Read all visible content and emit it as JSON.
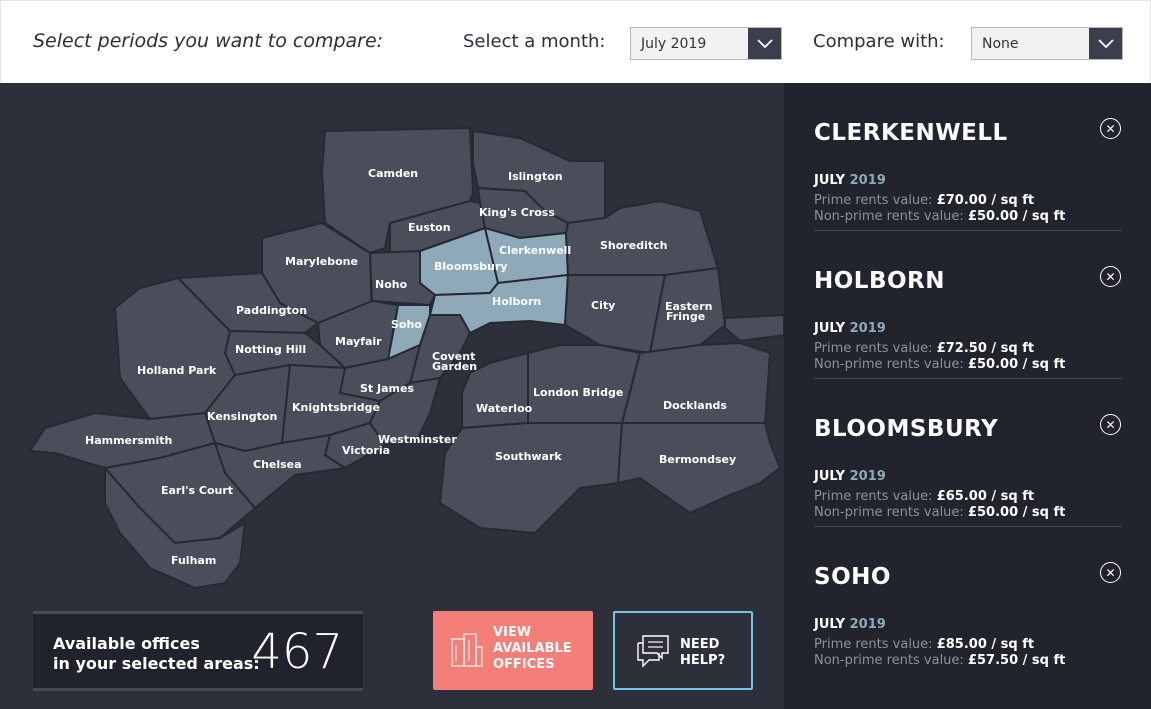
{
  "topbar": {
    "prompt": "Select periods you want to compare:",
    "month_label": "Select a month:",
    "month_value": "July 2019",
    "compare_label": "Compare with:",
    "compare_value": "None"
  },
  "colors": {
    "map_background": "#2d303a",
    "region": "#4a4e5b",
    "region_selected": "#8ea9b8",
    "side_panel": "#21242c",
    "view_button": "#f47f78",
    "help_border": "#6ec6e6"
  },
  "map": {
    "regions": [
      {
        "id": "camden",
        "label": "Camden",
        "selected": false
      },
      {
        "id": "islington",
        "label": "Islington",
        "selected": false
      },
      {
        "id": "kings-cross",
        "label": "King's Cross",
        "selected": false
      },
      {
        "id": "euston",
        "label": "Euston",
        "selected": false
      },
      {
        "id": "marylebone",
        "label": "Marylebone",
        "selected": false
      },
      {
        "id": "bloomsbury",
        "label": "Bloomsbury",
        "selected": true
      },
      {
        "id": "clerkenwell",
        "label": "Clerkenwell",
        "selected": true
      },
      {
        "id": "shoreditch",
        "label": "Shoreditch",
        "selected": false
      },
      {
        "id": "noho",
        "label": "Noho",
        "selected": false
      },
      {
        "id": "paddington",
        "label": "Paddington",
        "selected": false
      },
      {
        "id": "holborn",
        "label": "Holborn",
        "selected": true
      },
      {
        "id": "city",
        "label": "City",
        "selected": false
      },
      {
        "id": "eastern-fringe",
        "label": "Eastern Fringe",
        "selected": false
      },
      {
        "id": "soho",
        "label": "Soho",
        "selected": true
      },
      {
        "id": "mayfair",
        "label": "Mayfair",
        "selected": false
      },
      {
        "id": "notting-hill",
        "label": "Notting Hill",
        "selected": false
      },
      {
        "id": "holland-park",
        "label": "Holland Park",
        "selected": false
      },
      {
        "id": "covent-garden",
        "label": "Covent Garden",
        "selected": false
      },
      {
        "id": "st-james",
        "label": "St James",
        "selected": false
      },
      {
        "id": "kensington",
        "label": "Kensington",
        "selected": false
      },
      {
        "id": "knightsbridge",
        "label": "Knightsbridge",
        "selected": false
      },
      {
        "id": "london-bridge",
        "label": "London Bridge",
        "selected": false
      },
      {
        "id": "waterloo",
        "label": "Waterloo",
        "selected": false
      },
      {
        "id": "docklands",
        "label": "Docklands",
        "selected": false
      },
      {
        "id": "hammersmith",
        "label": "Hammersmith",
        "selected": false
      },
      {
        "id": "westminster",
        "label": "Westminster",
        "selected": false
      },
      {
        "id": "victoria",
        "label": "Victoria",
        "selected": false
      },
      {
        "id": "chelsea",
        "label": "Chelsea",
        "selected": false
      },
      {
        "id": "southwark",
        "label": "Southwark",
        "selected": false
      },
      {
        "id": "bermondsey",
        "label": "Bermondsey",
        "selected": false
      },
      {
        "id": "earls-court",
        "label": "Earl's Court",
        "selected": false
      },
      {
        "id": "fulham",
        "label": "Fulham",
        "selected": false
      }
    ]
  },
  "counter": {
    "line1": "Available offices",
    "line2": "in your selected areas:",
    "count": "467"
  },
  "buttons": {
    "view_line1": "VIEW",
    "view_line2": "AVAILABLE",
    "view_line3": "OFFICES",
    "help_line1": "NEED",
    "help_line2": "HELP?"
  },
  "cards": [
    {
      "name": "CLERKENWELL",
      "month": "JULY",
      "year": "2019",
      "prime_label": "Prime rents value:",
      "prime_value": "£70.00 / sq ft",
      "nonprime_label": "Non-prime rents value:",
      "nonprime_value": "£50.00 / sq ft"
    },
    {
      "name": "HOLBORN",
      "month": "JULY",
      "year": "2019",
      "prime_label": "Prime rents value:",
      "prime_value": "£72.50 / sq ft",
      "nonprime_label": "Non-prime rents value:",
      "nonprime_value": "£50.00 / sq ft"
    },
    {
      "name": "BLOOMSBURY",
      "month": "JULY",
      "year": "2019",
      "prime_label": "Prime rents value:",
      "prime_value": "£65.00 / sq ft",
      "nonprime_label": "Non-prime rents value:",
      "nonprime_value": "£50.00 / sq ft"
    },
    {
      "name": "SOHO",
      "month": "JULY",
      "year": "2019",
      "prime_label": "Prime rents value:",
      "prime_value": "£85.00 / sq ft",
      "nonprime_label": "Non-prime rents value:",
      "nonprime_value": "£57.50 / sq ft"
    }
  ]
}
